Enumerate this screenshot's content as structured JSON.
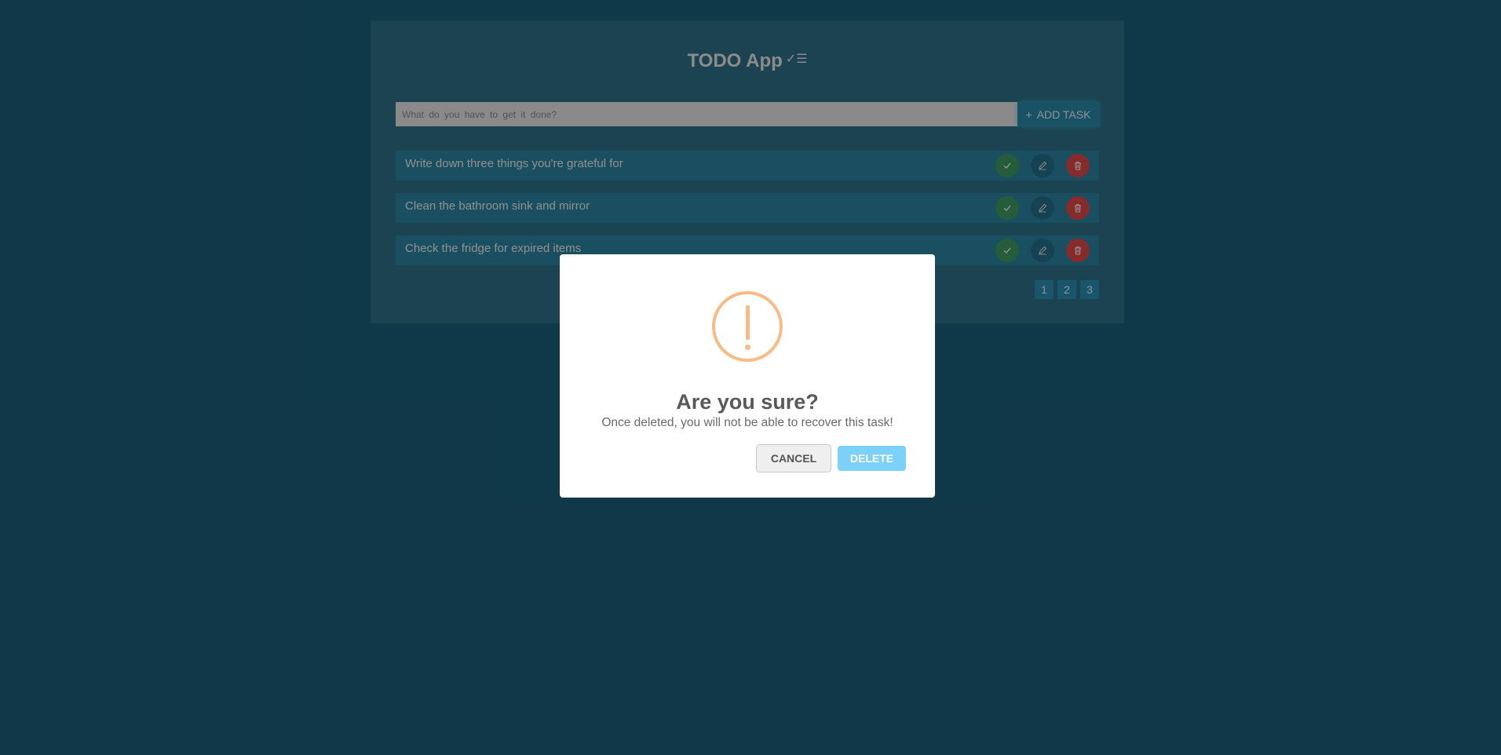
{
  "header": {
    "title": "TODO App",
    "title_icon": "checklist-icon"
  },
  "input": {
    "placeholder": "What do you have to get it done?",
    "value": ""
  },
  "add_button": {
    "icon": "+",
    "label": "ADD TASK"
  },
  "tasks": [
    {
      "text": "Write down three things you're grateful for"
    },
    {
      "text": "Clean the bathroom sink and mirror"
    },
    {
      "text": "Check the fridge for expired items"
    }
  ],
  "pagination": [
    "1",
    "2",
    "3"
  ],
  "dialog": {
    "title": "Are you sure?",
    "message": "Once deleted, you will not be able to recover this task!",
    "cancel_label": "CANCEL",
    "delete_label": "DELETE"
  },
  "colors": {
    "background": "#1a5e78",
    "card": "#2e7187",
    "task": "#2a84a2",
    "done": "#3e9a5f",
    "delete": "#e04848",
    "warning": "#f8bb86",
    "confirm": "#7cd1f9"
  }
}
